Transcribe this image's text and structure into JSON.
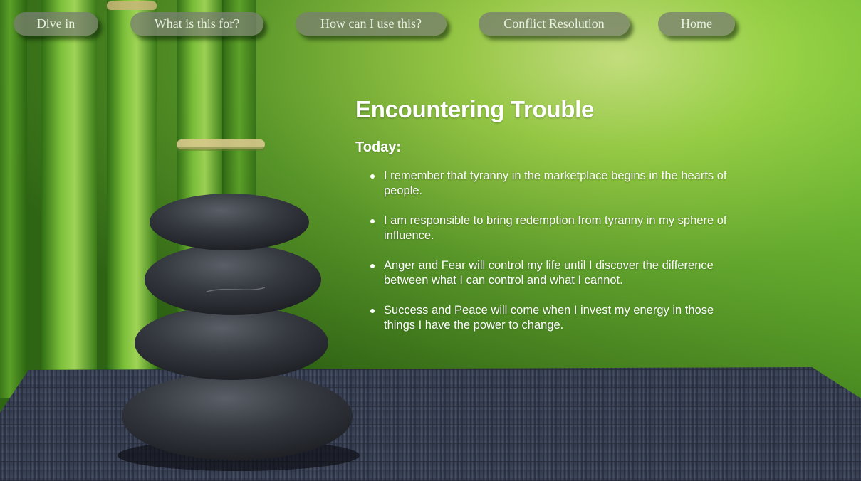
{
  "nav": {
    "items": [
      {
        "label": "Dive in"
      },
      {
        "label": "What is this for?"
      },
      {
        "label": "How can I use this?"
      },
      {
        "label": "Conflict Resolution"
      },
      {
        "label": "Home"
      }
    ]
  },
  "main": {
    "title": "Encountering Trouble",
    "subheading": "Today:",
    "points": [
      "I remember that tyranny in the marketplace begins in the hearts of people.",
      "I am responsible to bring redemption from tyranny in my sphere of influence.",
      "Anger and Fear will control my life until I discover the difference between what I can control and what I cannot.",
      "Success and Peace will come when I invest my energy in those things I have the power to change."
    ]
  },
  "colors": {
    "background_green": "#7cc43a",
    "nav_button": "#7a806e",
    "text": "#ffffff",
    "mat": "#2b2f3d",
    "stone": "#2e3238"
  }
}
